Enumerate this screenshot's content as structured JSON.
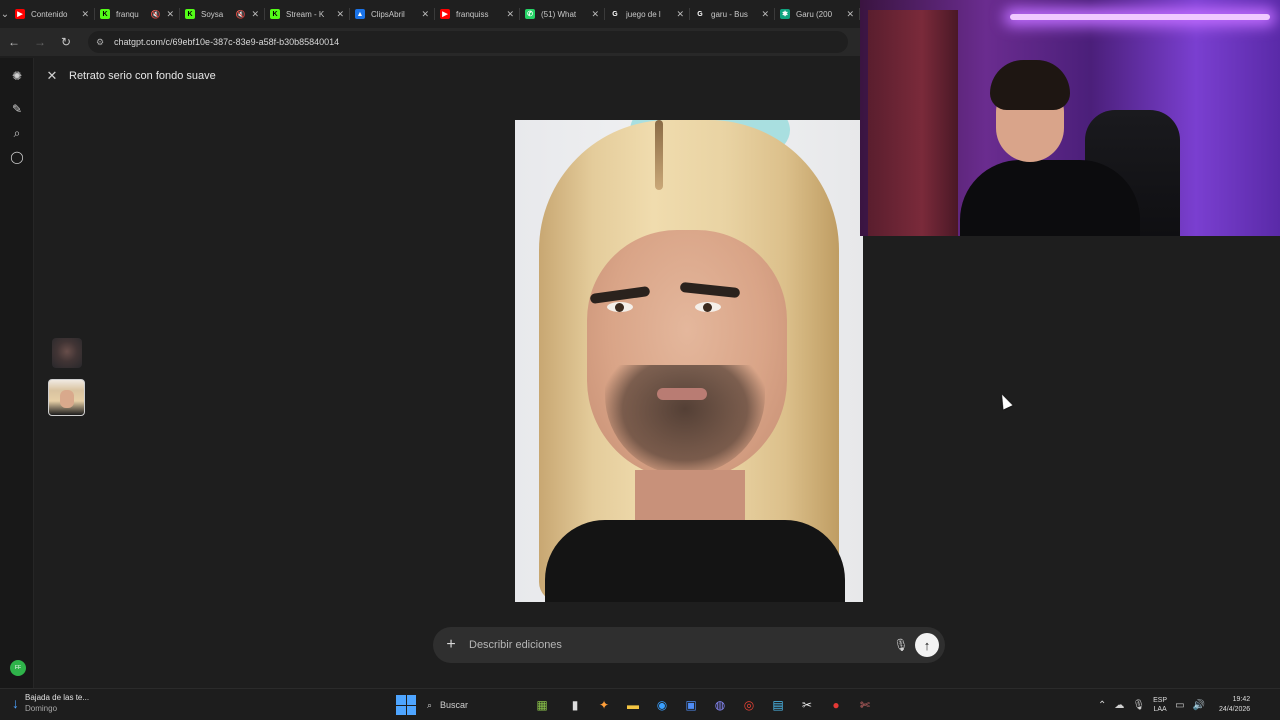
{
  "browser": {
    "tabs": [
      {
        "title": "Contenido",
        "favicon_color": "#ff0000",
        "favicon_glyph": "▶",
        "muted": false
      },
      {
        "title": "franqu",
        "favicon_color": "#53fc18",
        "favicon_glyph": "K",
        "muted": true
      },
      {
        "title": "Soysa",
        "favicon_color": "#53fc18",
        "favicon_glyph": "K",
        "muted": true
      },
      {
        "title": "Stream - K",
        "favicon_color": "#53fc18",
        "favicon_glyph": "K",
        "muted": false
      },
      {
        "title": "ClipsAbril",
        "favicon_color": "#1a73e8",
        "favicon_glyph": "▲",
        "muted": false
      },
      {
        "title": "franquiss",
        "favicon_color": "#ff0000",
        "favicon_glyph": "▶",
        "muted": false
      },
      {
        "title": "(51) What",
        "favicon_color": "#25d366",
        "favicon_glyph": "✆",
        "muted": false
      },
      {
        "title": "juego de l",
        "favicon_color": "#ffffff",
        "favicon_glyph": "G",
        "muted": false
      },
      {
        "title": "garu - Bus",
        "favicon_color": "#ffffff",
        "favicon_glyph": "G",
        "muted": false
      },
      {
        "title": "Garu (200",
        "favicon_color": "#10a37f",
        "favicon_glyph": "✱",
        "muted": false
      }
    ],
    "url": "chatgpt.com/c/69ebf10e-387c-83e9-a58f-b30b85840014"
  },
  "header": {
    "title": "Retrato serio con fondo suave"
  },
  "rail": {
    "icons": [
      "openai-logo-icon",
      "new-chat-icon",
      "search-icon",
      "chat-bubble-icon"
    ],
    "avatar_initials": "FF",
    "avatar_color": "#2fb34a"
  },
  "prompt": {
    "placeholder": "Describir ediciones"
  },
  "taskbar": {
    "weather_title": "Bajada de las te...",
    "weather_subtitle": "Domingo",
    "search_label": "Buscar",
    "lang_top": "ESP",
    "lang_bottom": "LAA",
    "time": "19:42",
    "date": "24/4/2026"
  }
}
